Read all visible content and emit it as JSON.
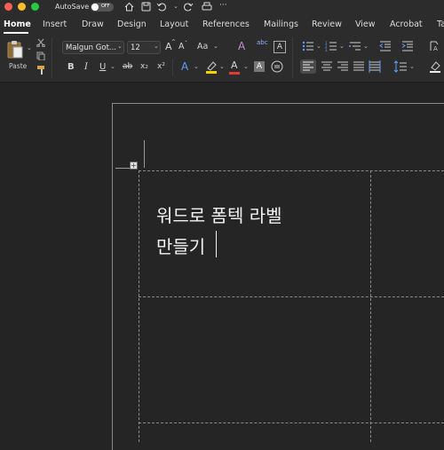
{
  "titlebar": {
    "autosave_label": "AutoSave",
    "autosave_state": "OFF",
    "icons": [
      "home-icon",
      "save-icon",
      "undo-icon",
      "redo-icon",
      "print-icon",
      "more-icon"
    ],
    "more_glyph": "···"
  },
  "tabs": [
    "Home",
    "Insert",
    "Draw",
    "Design",
    "Layout",
    "References",
    "Mailings",
    "Review",
    "View",
    "Acrobat",
    "Ta"
  ],
  "active_tab": "Home",
  "ribbon": {
    "paste_label": "Paste",
    "font_name": "Malgun Got...",
    "font_size": "12",
    "aa_label": "Aa",
    "bold": "B",
    "italic": "I",
    "underline": "U",
    "strike": "ab",
    "subscript": "x₂",
    "superscript": "x²",
    "grow_font": "A",
    "shrink_font": "A",
    "font_color_glyph": "A",
    "highlight_color": "#f2d200",
    "font_color": "#e53935"
  },
  "document": {
    "line1": "워드로 폼텍 라벨",
    "line2": "만들기"
  }
}
